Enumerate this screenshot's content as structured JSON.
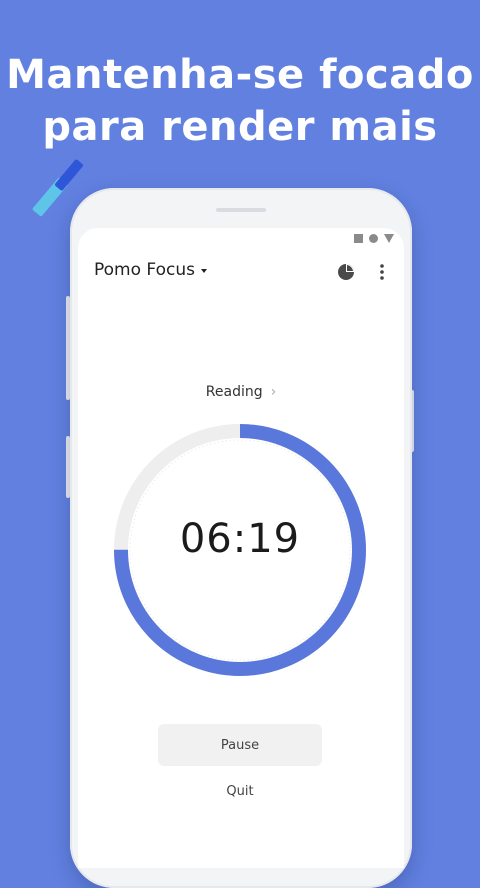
{
  "promo": {
    "line1": "Mantenha-se focado",
    "line2": "para render mais"
  },
  "colors": {
    "background": "#6180e0",
    "accent": "#5a78dc",
    "track": "#eeeeee"
  },
  "app": {
    "title": "Pomo Focus",
    "stats_icon": "pie-chart-icon",
    "menu_icon": "more-vertical-icon"
  },
  "status_bar": {
    "icons": [
      "signal-square-icon",
      "wifi-circle-icon",
      "battery-triangle-icon"
    ]
  },
  "timer": {
    "task_label": "Reading",
    "time": "06:19",
    "progress": 0.75
  },
  "actions": {
    "pause_label": "Pause",
    "quit_label": "Quit"
  }
}
